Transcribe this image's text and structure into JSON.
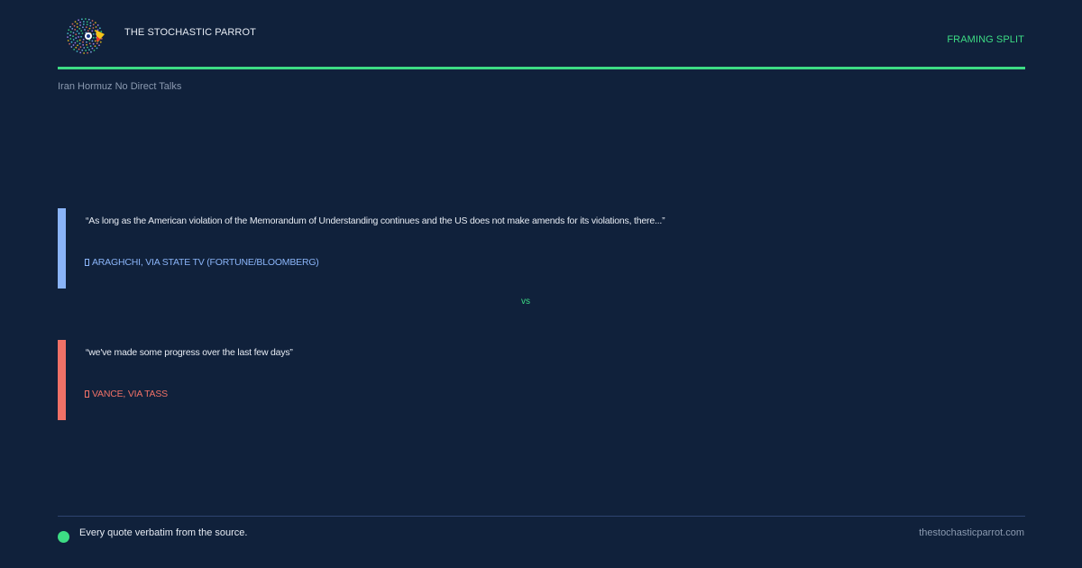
{
  "header": {
    "brand": "THE STOCHASTIC PARROT",
    "tag": "FRAMING SPLIT",
    "story": "Iran Hormuz No Direct Talks"
  },
  "quotes": [
    {
      "text": "“As long as the American violation of the Memorandum of Understanding continues and the US does not make amends for its violations, there...”",
      "attribution": "ARAGHCHI, VIA STATE TV (FORTUNE/BLOOMBERG)",
      "accent": "#8ab4f8"
    },
    {
      "text": "“we've made some progress over the last few days”",
      "attribution": "VANCE, VIA TASS",
      "accent": "#f07167"
    }
  ],
  "divider": "vs",
  "footer": {
    "note": "Every quote verbatim from the source.",
    "site": "thestochasticparrot.com"
  },
  "colors": {
    "background": "#10213b",
    "accent_green": "#3ddc84",
    "quote_a": "#8ab4f8",
    "quote_b": "#f07167"
  },
  "icons": {
    "logo": "parrot-logo-icon",
    "attribution": "speaker-icon",
    "footer_dot": "status-dot-icon"
  }
}
